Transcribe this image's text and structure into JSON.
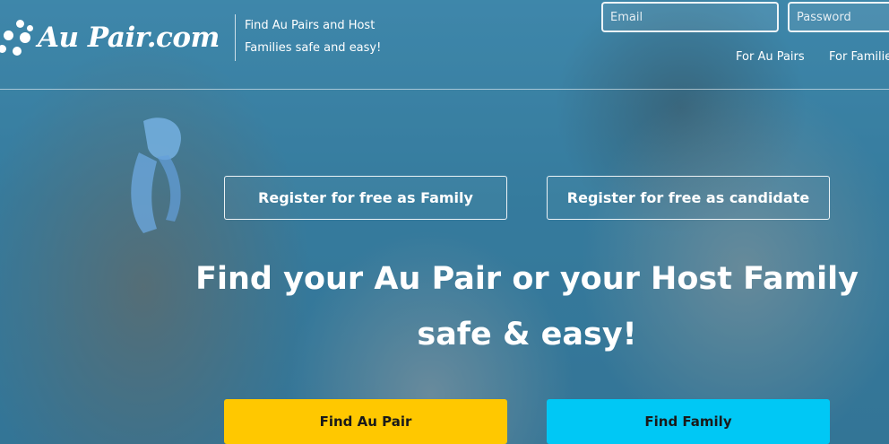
{
  "header": {
    "logo_text": "Au Pair.com",
    "tagline_line1": "Find Au Pairs and Host",
    "tagline_line2": "Families safe and easy!",
    "email_placeholder": "Email",
    "password_placeholder": "Password",
    "nav": {
      "au_pairs": "For Au Pairs",
      "families": "For Families"
    }
  },
  "main": {
    "register_family": "Register for free as Family",
    "register_candidate": "Register for free as candidate",
    "headline_line1": "Find your Au Pair or your Host Family",
    "headline_line2": "safe & easy!",
    "find_au_pair": "Find Au Pair",
    "find_family": "Find Family"
  },
  "colors": {
    "find_au_pair_bg": "#ffc800",
    "find_family_bg": "#00c8f5",
    "overlay": "#2878a0"
  }
}
